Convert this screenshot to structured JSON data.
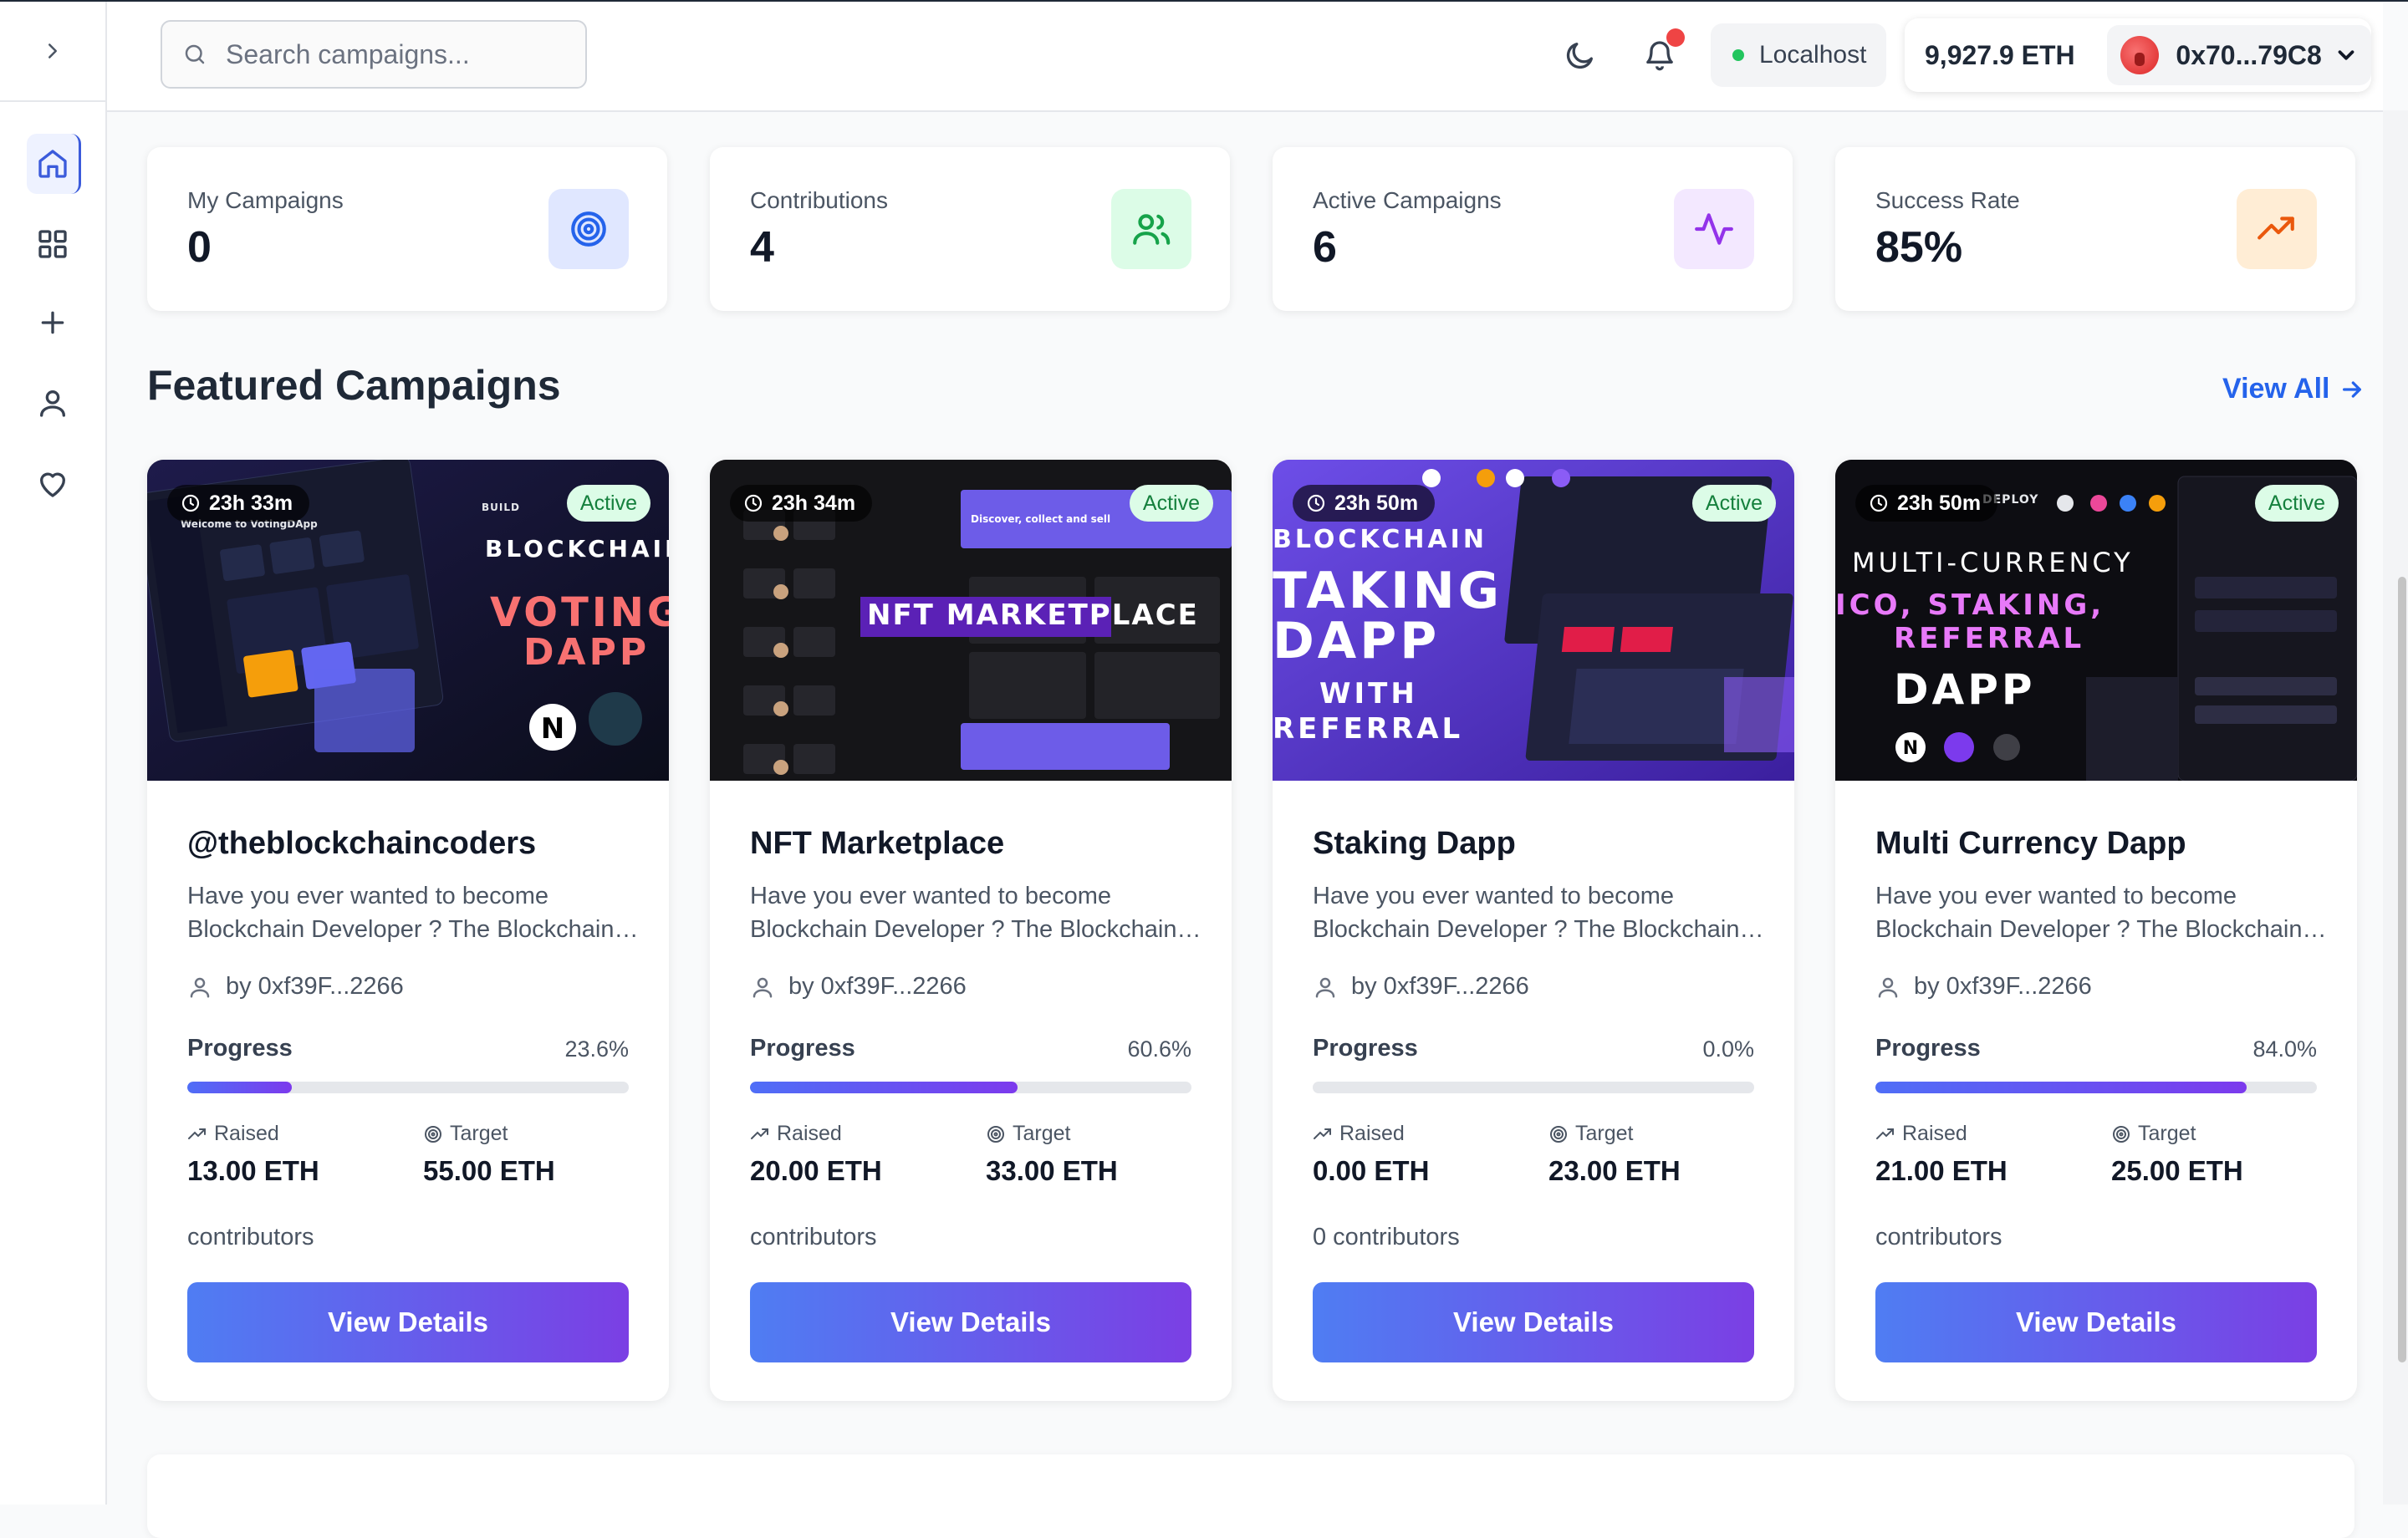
{
  "header": {
    "search_placeholder": "Search campaigns...",
    "network": "Localhost",
    "balance": "9,927.9 ETH",
    "address": "0x70...79C8"
  },
  "sidebar": {
    "items": [
      {
        "name": "home-icon",
        "active": true
      },
      {
        "name": "grid-icon",
        "active": false
      },
      {
        "name": "plus-icon",
        "active": false
      },
      {
        "name": "user-icon",
        "active": false
      },
      {
        "name": "heart-icon",
        "active": false
      }
    ]
  },
  "stats": [
    {
      "label": "My Campaigns",
      "value": "0",
      "icon": "target-icon",
      "bg": "#e0e7ff",
      "color": "#2563eb"
    },
    {
      "label": "Contributions",
      "value": "4",
      "icon": "users-icon",
      "bg": "#dcfce7",
      "color": "#16a34a"
    },
    {
      "label": "Active Campaigns",
      "value": "6",
      "icon": "activity-icon",
      "bg": "#f3e8ff",
      "color": "#9333ea"
    },
    {
      "label": "Success Rate",
      "value": "85%",
      "icon": "trending-up-icon",
      "bg": "#ffedd5",
      "color": "#ea580c"
    }
  ],
  "featured": {
    "title": "Featured Campaigns",
    "view_all": "View All",
    "campaigns": [
      {
        "timer": "23h 33m",
        "status": "Active",
        "title": "@theblockchaincoders",
        "desc_line1": "Have you ever wanted to become",
        "desc_line2": "Blockchain Developer ? The Blockchain Coders",
        "creator": "by 0xf39F...2266",
        "progress_label": "Progress",
        "progress_text": "23.6%",
        "progress": 0.236,
        "raised_label": "Raised",
        "raised": "13.00 ETH",
        "target_label": "Target",
        "target": "55.00 ETH",
        "contributors": "contributors",
        "button": "View Details",
        "art": {
          "line1": "BLOCKCHAIN",
          "line2": "VOTING",
          "line3": "DAPP",
          "small": "BUILD",
          "panel": "Welcome to VotingDApp"
        }
      },
      {
        "timer": "23h 34m",
        "status": "Active",
        "title": "NFT Marketplace",
        "desc_line1": "Have you ever wanted to become",
        "desc_line2": "Blockchain Developer ? The Blockchain Coders",
        "creator": "by 0xf39F...2266",
        "progress_label": "Progress",
        "progress_text": "60.6%",
        "progress": 0.606,
        "raised_label": "Raised",
        "raised": "20.00 ETH",
        "target_label": "Target",
        "target": "33.00 ETH",
        "contributors": "contributors",
        "button": "View Details",
        "art": {
          "line1": "NFT MARKETPLACE",
          "panel": "Discover, collect and sell"
        }
      },
      {
        "timer": "23h 50m",
        "status": "Active",
        "title": "Staking Dapp",
        "desc_line1": "Have you ever wanted to become",
        "desc_line2": "Blockchain Developer ? The Blockchain Coders",
        "creator": "by 0xf39F...2266",
        "progress_label": "Progress",
        "progress_text": "0.0%",
        "progress": 0.0,
        "raised_label": "Raised",
        "raised": "0.00 ETH",
        "target_label": "Target",
        "target": "23.00 ETH",
        "contributors": "0 contributors",
        "button": "View Details",
        "art": {
          "line1": "BLOCKCHAIN",
          "line2": "TAKING",
          "line3": "DAPP",
          "line4": "WITH",
          "line5": "REFERRAL"
        }
      },
      {
        "timer": "23h 50m",
        "status": "Active",
        "title": "Multi Currency Dapp",
        "desc_line1": "Have you ever wanted to become",
        "desc_line2": "Blockchain Developer ? The Blockchain Coders",
        "creator": "by 0xf39F...2266",
        "progress_label": "Progress",
        "progress_text": "84.0%",
        "progress": 0.84,
        "raised_label": "Raised",
        "raised": "21.00 ETH",
        "target_label": "Target",
        "target": "25.00 ETH",
        "contributors": "contributors",
        "button": "View Details",
        "art": {
          "line1": "MULTI-CURRENCY",
          "line2": "ICO, STAKING,",
          "line3": "REFERRAL",
          "line4": "DAPP",
          "small": "DEPLOY"
        }
      }
    ]
  }
}
